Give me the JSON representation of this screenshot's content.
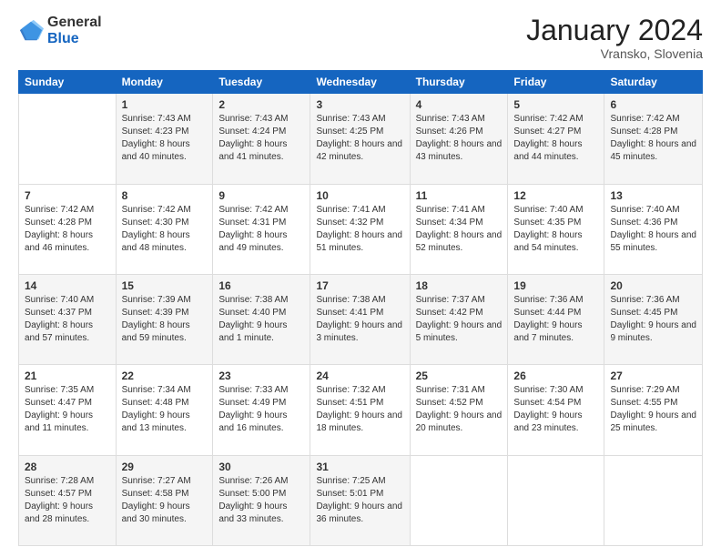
{
  "logo": {
    "general": "General",
    "blue": "Blue"
  },
  "header": {
    "month": "January 2024",
    "location": "Vransko, Slovenia"
  },
  "weekdays": [
    "Sunday",
    "Monday",
    "Tuesday",
    "Wednesday",
    "Thursday",
    "Friday",
    "Saturday"
  ],
  "weeks": [
    [
      {
        "day": "",
        "sunrise": "",
        "sunset": "",
        "daylight": ""
      },
      {
        "day": "1",
        "sunrise": "Sunrise: 7:43 AM",
        "sunset": "Sunset: 4:23 PM",
        "daylight": "Daylight: 8 hours and 40 minutes."
      },
      {
        "day": "2",
        "sunrise": "Sunrise: 7:43 AM",
        "sunset": "Sunset: 4:24 PM",
        "daylight": "Daylight: 8 hours and 41 minutes."
      },
      {
        "day": "3",
        "sunrise": "Sunrise: 7:43 AM",
        "sunset": "Sunset: 4:25 PM",
        "daylight": "Daylight: 8 hours and 42 minutes."
      },
      {
        "day": "4",
        "sunrise": "Sunrise: 7:43 AM",
        "sunset": "Sunset: 4:26 PM",
        "daylight": "Daylight: 8 hours and 43 minutes."
      },
      {
        "day": "5",
        "sunrise": "Sunrise: 7:42 AM",
        "sunset": "Sunset: 4:27 PM",
        "daylight": "Daylight: 8 hours and 44 minutes."
      },
      {
        "day": "6",
        "sunrise": "Sunrise: 7:42 AM",
        "sunset": "Sunset: 4:28 PM",
        "daylight": "Daylight: 8 hours and 45 minutes."
      }
    ],
    [
      {
        "day": "7",
        "sunrise": "Sunrise: 7:42 AM",
        "sunset": "Sunset: 4:28 PM",
        "daylight": "Daylight: 8 hours and 46 minutes."
      },
      {
        "day": "8",
        "sunrise": "Sunrise: 7:42 AM",
        "sunset": "Sunset: 4:30 PM",
        "daylight": "Daylight: 8 hours and 48 minutes."
      },
      {
        "day": "9",
        "sunrise": "Sunrise: 7:42 AM",
        "sunset": "Sunset: 4:31 PM",
        "daylight": "Daylight: 8 hours and 49 minutes."
      },
      {
        "day": "10",
        "sunrise": "Sunrise: 7:41 AM",
        "sunset": "Sunset: 4:32 PM",
        "daylight": "Daylight: 8 hours and 51 minutes."
      },
      {
        "day": "11",
        "sunrise": "Sunrise: 7:41 AM",
        "sunset": "Sunset: 4:34 PM",
        "daylight": "Daylight: 8 hours and 52 minutes."
      },
      {
        "day": "12",
        "sunrise": "Sunrise: 7:40 AM",
        "sunset": "Sunset: 4:35 PM",
        "daylight": "Daylight: 8 hours and 54 minutes."
      },
      {
        "day": "13",
        "sunrise": "Sunrise: 7:40 AM",
        "sunset": "Sunset: 4:36 PM",
        "daylight": "Daylight: 8 hours and 55 minutes."
      }
    ],
    [
      {
        "day": "14",
        "sunrise": "Sunrise: 7:40 AM",
        "sunset": "Sunset: 4:37 PM",
        "daylight": "Daylight: 8 hours and 57 minutes."
      },
      {
        "day": "15",
        "sunrise": "Sunrise: 7:39 AM",
        "sunset": "Sunset: 4:39 PM",
        "daylight": "Daylight: 8 hours and 59 minutes."
      },
      {
        "day": "16",
        "sunrise": "Sunrise: 7:38 AM",
        "sunset": "Sunset: 4:40 PM",
        "daylight": "Daylight: 9 hours and 1 minute."
      },
      {
        "day": "17",
        "sunrise": "Sunrise: 7:38 AM",
        "sunset": "Sunset: 4:41 PM",
        "daylight": "Daylight: 9 hours and 3 minutes."
      },
      {
        "day": "18",
        "sunrise": "Sunrise: 7:37 AM",
        "sunset": "Sunset: 4:42 PM",
        "daylight": "Daylight: 9 hours and 5 minutes."
      },
      {
        "day": "19",
        "sunrise": "Sunrise: 7:36 AM",
        "sunset": "Sunset: 4:44 PM",
        "daylight": "Daylight: 9 hours and 7 minutes."
      },
      {
        "day": "20",
        "sunrise": "Sunrise: 7:36 AM",
        "sunset": "Sunset: 4:45 PM",
        "daylight": "Daylight: 9 hours and 9 minutes."
      }
    ],
    [
      {
        "day": "21",
        "sunrise": "Sunrise: 7:35 AM",
        "sunset": "Sunset: 4:47 PM",
        "daylight": "Daylight: 9 hours and 11 minutes."
      },
      {
        "day": "22",
        "sunrise": "Sunrise: 7:34 AM",
        "sunset": "Sunset: 4:48 PM",
        "daylight": "Daylight: 9 hours and 13 minutes."
      },
      {
        "day": "23",
        "sunrise": "Sunrise: 7:33 AM",
        "sunset": "Sunset: 4:49 PM",
        "daylight": "Daylight: 9 hours and 16 minutes."
      },
      {
        "day": "24",
        "sunrise": "Sunrise: 7:32 AM",
        "sunset": "Sunset: 4:51 PM",
        "daylight": "Daylight: 9 hours and 18 minutes."
      },
      {
        "day": "25",
        "sunrise": "Sunrise: 7:31 AM",
        "sunset": "Sunset: 4:52 PM",
        "daylight": "Daylight: 9 hours and 20 minutes."
      },
      {
        "day": "26",
        "sunrise": "Sunrise: 7:30 AM",
        "sunset": "Sunset: 4:54 PM",
        "daylight": "Daylight: 9 hours and 23 minutes."
      },
      {
        "day": "27",
        "sunrise": "Sunrise: 7:29 AM",
        "sunset": "Sunset: 4:55 PM",
        "daylight": "Daylight: 9 hours and 25 minutes."
      }
    ],
    [
      {
        "day": "28",
        "sunrise": "Sunrise: 7:28 AM",
        "sunset": "Sunset: 4:57 PM",
        "daylight": "Daylight: 9 hours and 28 minutes."
      },
      {
        "day": "29",
        "sunrise": "Sunrise: 7:27 AM",
        "sunset": "Sunset: 4:58 PM",
        "daylight": "Daylight: 9 hours and 30 minutes."
      },
      {
        "day": "30",
        "sunrise": "Sunrise: 7:26 AM",
        "sunset": "Sunset: 5:00 PM",
        "daylight": "Daylight: 9 hours and 33 minutes."
      },
      {
        "day": "31",
        "sunrise": "Sunrise: 7:25 AM",
        "sunset": "Sunset: 5:01 PM",
        "daylight": "Daylight: 9 hours and 36 minutes."
      },
      {
        "day": "",
        "sunrise": "",
        "sunset": "",
        "daylight": ""
      },
      {
        "day": "",
        "sunrise": "",
        "sunset": "",
        "daylight": ""
      },
      {
        "day": "",
        "sunrise": "",
        "sunset": "",
        "daylight": ""
      }
    ]
  ]
}
